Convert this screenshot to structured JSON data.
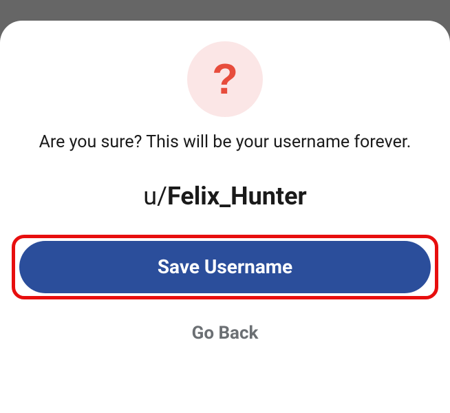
{
  "dialog": {
    "icon": "question-mark",
    "message": "Are you sure? This will be your username forever.",
    "username_prefix": "u/",
    "username_value": "Felix_Hunter",
    "save_label": "Save Username",
    "go_back_label": "Go Back"
  }
}
